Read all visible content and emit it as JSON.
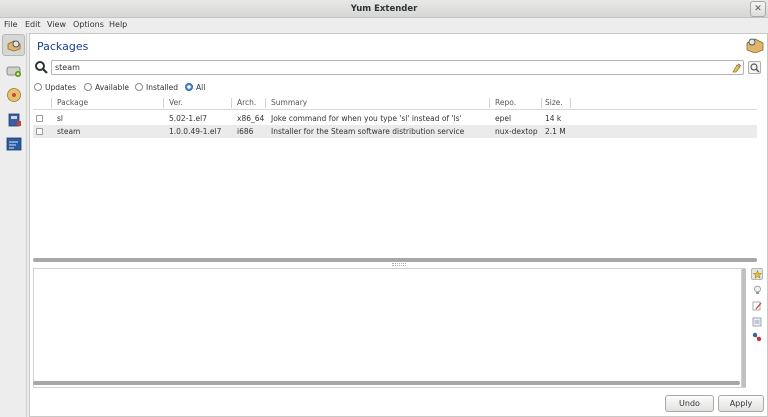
{
  "window": {
    "title": "Yum Extender"
  },
  "menu": {
    "file": "File",
    "edit": "Edit",
    "view": "View",
    "options": "Options",
    "help": "Help"
  },
  "page": {
    "title": "Packages"
  },
  "search": {
    "value": "steam"
  },
  "filters": {
    "updates": "Updates",
    "available": "Available",
    "installed": "Installed",
    "all": "All",
    "selected": "All"
  },
  "table": {
    "headers": {
      "package": "Package",
      "version": "Ver.",
      "arch": "Arch.",
      "summary": "Summary",
      "repo": "Repo.",
      "size": "Size."
    },
    "rows": [
      {
        "package": "sl",
        "version": "5.02-1.el7",
        "arch": "x86_64",
        "summary": "Joke command for when you type 'sl' instead of 'ls'",
        "repo": "epel",
        "size": "14 k"
      },
      {
        "package": "steam",
        "version": "1.0.0.49-1.el7",
        "arch": "i686",
        "summary": "Installer for the Steam software distribution service",
        "repo": "nux-dextop",
        "size": "2.1 M"
      }
    ]
  },
  "buttons": {
    "undo": "Undo",
    "apply": "Apply"
  },
  "colors": {
    "accent": "#1a3e8a",
    "selection": "#4a90d9"
  }
}
